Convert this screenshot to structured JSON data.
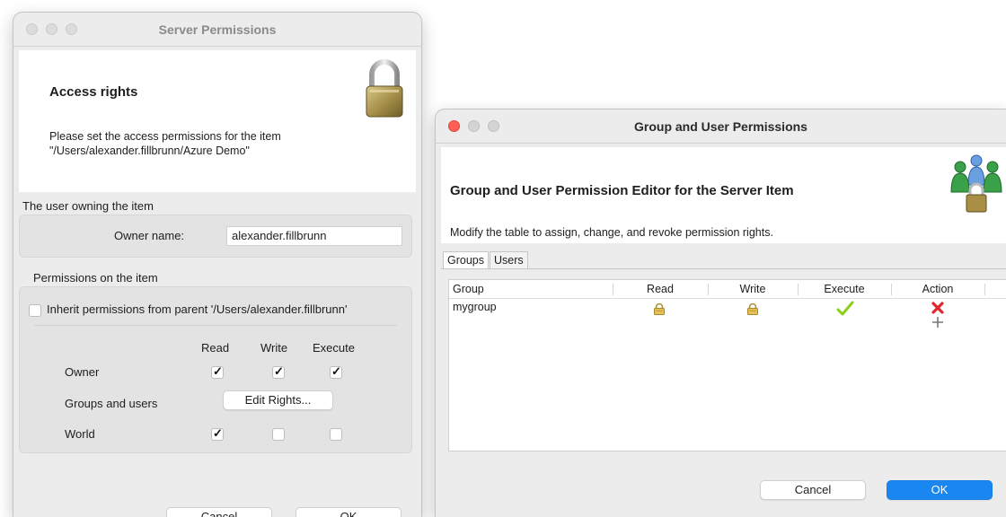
{
  "server_permissions": {
    "window_title": "Server Permissions",
    "header_title": "Access rights",
    "header_desc": "Please set the access permissions for the item\n\"/Users/alexander.fillbrunn/Azure Demo\"",
    "owner_section_label": "The user owning the item",
    "owner_name_label": "Owner name:",
    "owner_name_value": "alexander.fillbrunn",
    "permissions_section_label": "Permissions on the item",
    "inherit_label": "Inherit permissions from parent '/Users/alexander.fillbrunn'",
    "inherit_checked": false,
    "columns": [
      "Read",
      "Write",
      "Execute"
    ],
    "rows": {
      "owner": {
        "label": "Owner",
        "read": true,
        "write": true,
        "execute": true
      },
      "groups": {
        "label": "Groups and users",
        "button_label": "Edit Rights..."
      },
      "world": {
        "label": "World",
        "read": true,
        "write": false,
        "execute": false
      }
    },
    "cancel_label": "Cancel",
    "ok_label": "OK"
  },
  "group_permissions": {
    "window_title": "Group and User Permissions",
    "header_title": "Group and User Permission Editor for the Server Item",
    "header_desc": "Modify the table to assign, change, and revoke permission rights.",
    "tabs": [
      {
        "label": "Groups",
        "active": true
      },
      {
        "label": "Users",
        "active": false
      }
    ],
    "table": {
      "headers": {
        "group": "Group",
        "read": "Read",
        "write": "Write",
        "execute": "Execute",
        "action": "Action"
      },
      "rows": [
        {
          "group": "mygroup",
          "read": "lock-icon",
          "write": "lock-icon",
          "execute": "checkmark-icon",
          "action": [
            "delete-x-icon",
            "add-plus-icon"
          ]
        }
      ]
    },
    "cancel_label": "Cancel",
    "ok_label": "OK"
  },
  "colors": {
    "accent_button": "#1a86f0",
    "close_red": "#ff5f57",
    "delete_red": "#e3262d",
    "execute_green": "#8ccf1a"
  }
}
